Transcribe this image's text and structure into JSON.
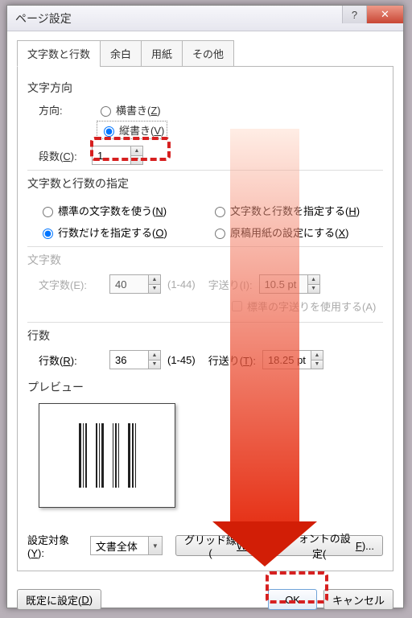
{
  "title": "ページ設定",
  "tabs": [
    "文字数と行数",
    "余白",
    "用紙",
    "その他"
  ],
  "active_tab": 0,
  "direction": {
    "group": "文字方向",
    "label": "方向:",
    "horizontal_prefix": "横書き(",
    "horizontal_hot": "Z",
    "horizontal_suffix": ")",
    "vertical_prefix": "縦書き(",
    "vertical_hot": "V",
    "vertical_suffix": ")",
    "selected": "vertical"
  },
  "columns": {
    "label_prefix": "段数(",
    "label_hot": "C",
    "label_suffix": "):",
    "value": "1"
  },
  "spec": {
    "title": "文字数と行数の指定",
    "opt_std_prefix": "標準の文字数を使う(",
    "opt_std_hot": "N",
    "opt_std_suffix": ")",
    "opt_both_prefix": "文字数と行数を指定する(",
    "opt_both_hot": "H",
    "opt_both_suffix": ")",
    "opt_lines_prefix": "行数だけを指定する(",
    "opt_lines_hot": "O",
    "opt_lines_suffix": ")",
    "opt_grid_prefix": "原稿用紙の設定にする(",
    "opt_grid_hot": "X",
    "opt_grid_suffix": ")",
    "selected": "lines"
  },
  "chars": {
    "title": "文字数",
    "count_label": "文字数(E):",
    "count_value": "40",
    "count_range": "(1-44)",
    "pitch_label": "字送り(I):",
    "pitch_value": "10.5 pt",
    "stdpitch_label": "標準の字送りを使用する(A)"
  },
  "lines": {
    "title": "行数",
    "count_label_prefix": "行数(",
    "count_hot": "R",
    "count_suffix": "):",
    "count_value": "36",
    "count_range": "(1-45)",
    "pitch_label_prefix": "行送り(",
    "pitch_hot": "T",
    "pitch_suffix": "):",
    "pitch_value": "18.25 pt"
  },
  "preview_label": "プレビュー",
  "apply": {
    "label_prefix": "設定対象(",
    "label_hot": "Y",
    "label_suffix": "):",
    "value": "文書全体"
  },
  "grid_btn_prefix": "グリッド線(",
  "grid_btn_hot": "W",
  "grid_btn_suffix": ")...",
  "font_btn_prefix": "フォントの設定(",
  "font_btn_hot": "F",
  "font_btn_suffix": ")...",
  "default_btn_prefix": "既定に設定(",
  "default_hot": "D",
  "default_btn_suffix": ")",
  "ok": "OK",
  "cancel": "キャンセル"
}
